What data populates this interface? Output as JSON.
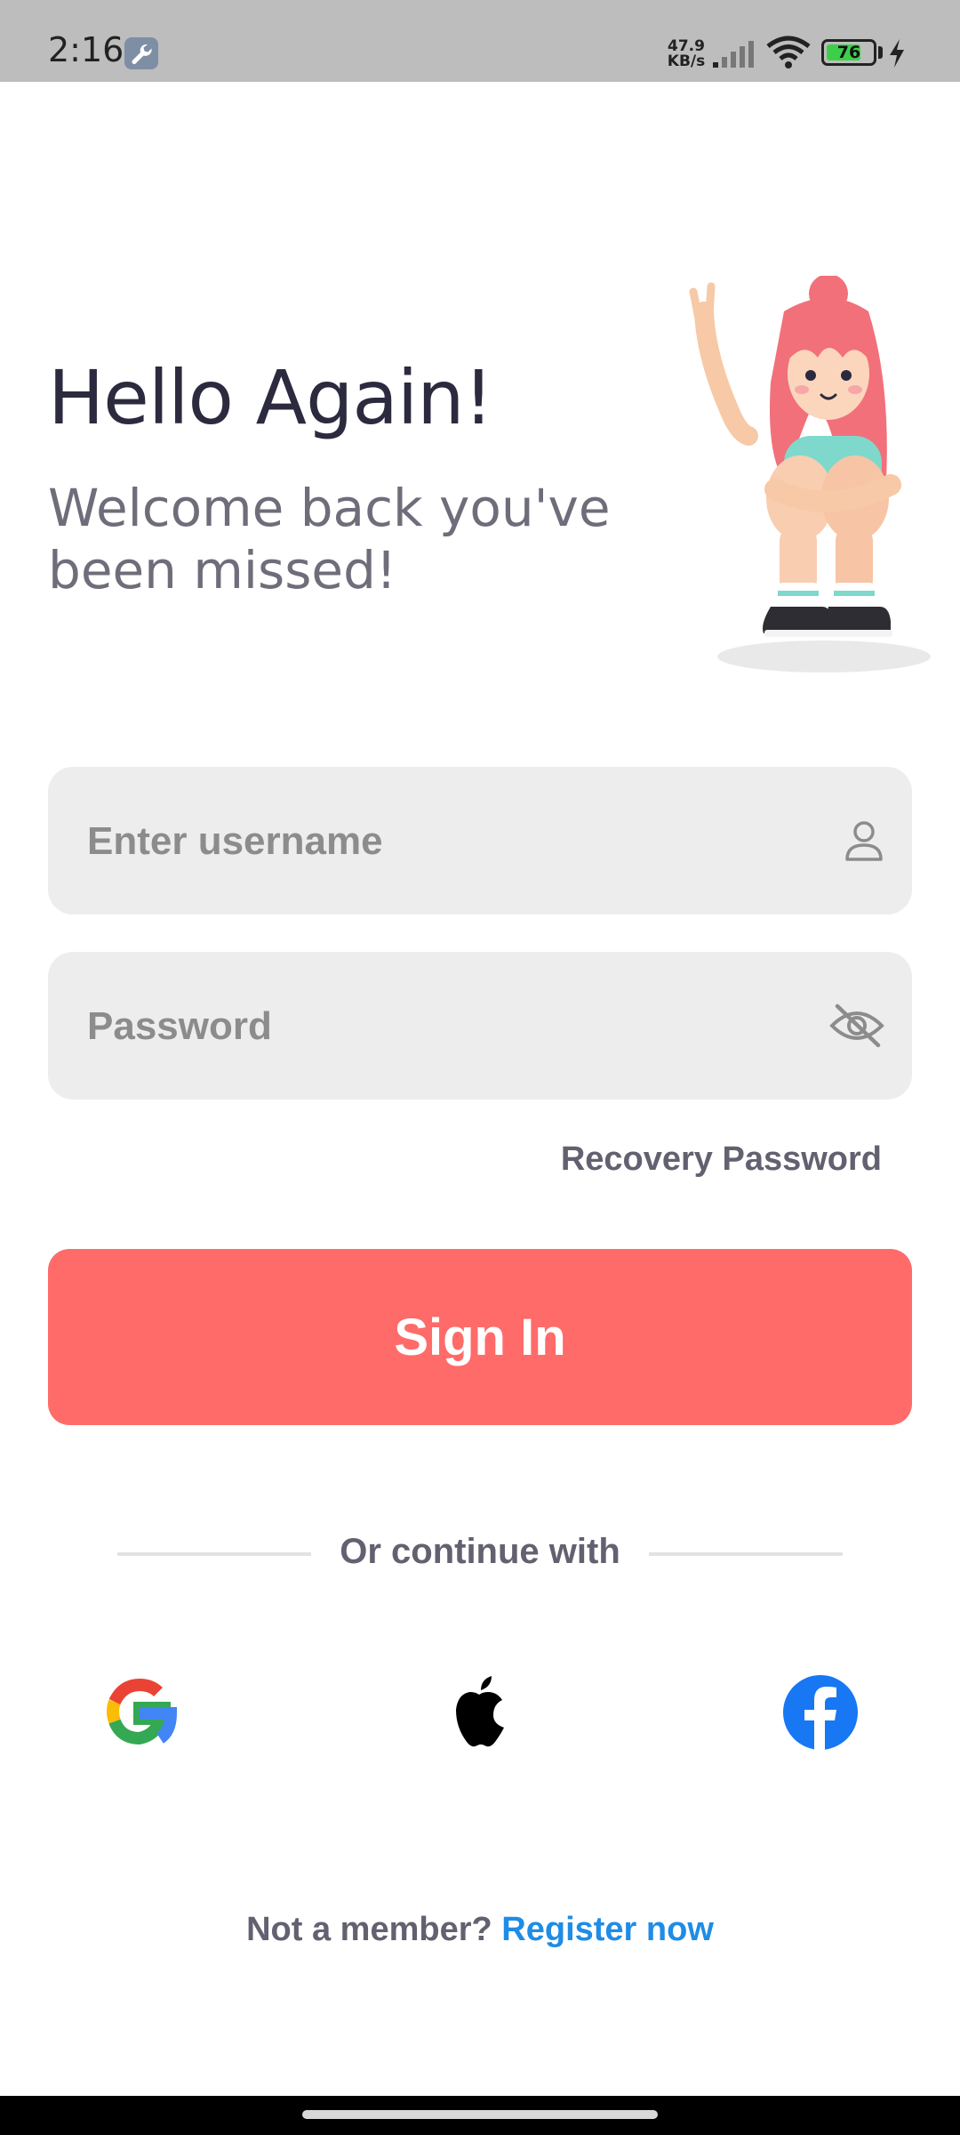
{
  "status_bar": {
    "time": "2:16",
    "net_speed_value": "47.9",
    "net_speed_unit": "KB/s",
    "battery_level": "76",
    "battery_fraction": 0.76,
    "icons": [
      "wrench-icon",
      "signal-icon",
      "wifi-icon",
      "battery-icon",
      "charging-bolt-icon"
    ]
  },
  "header": {
    "title": "Hello Again!",
    "subtitle": "Welcome back you've been missed!"
  },
  "form": {
    "username_placeholder": "Enter username",
    "username_value": "",
    "password_placeholder": "Password",
    "password_value": "",
    "recovery_label": "Recovery Password",
    "sign_in_label": "Sign In"
  },
  "divider": {
    "label": "Or continue with"
  },
  "social": {
    "providers": [
      "google",
      "apple",
      "facebook"
    ]
  },
  "footer": {
    "prompt": "Not a member?",
    "register_label": "Register now"
  },
  "colors": {
    "accent": "#ff6b69",
    "link": "#1f8ce6",
    "field_bg": "#ededed",
    "title": "#2b2a3e",
    "subtitle": "#6f6d7a",
    "facebook": "#1877f2"
  }
}
